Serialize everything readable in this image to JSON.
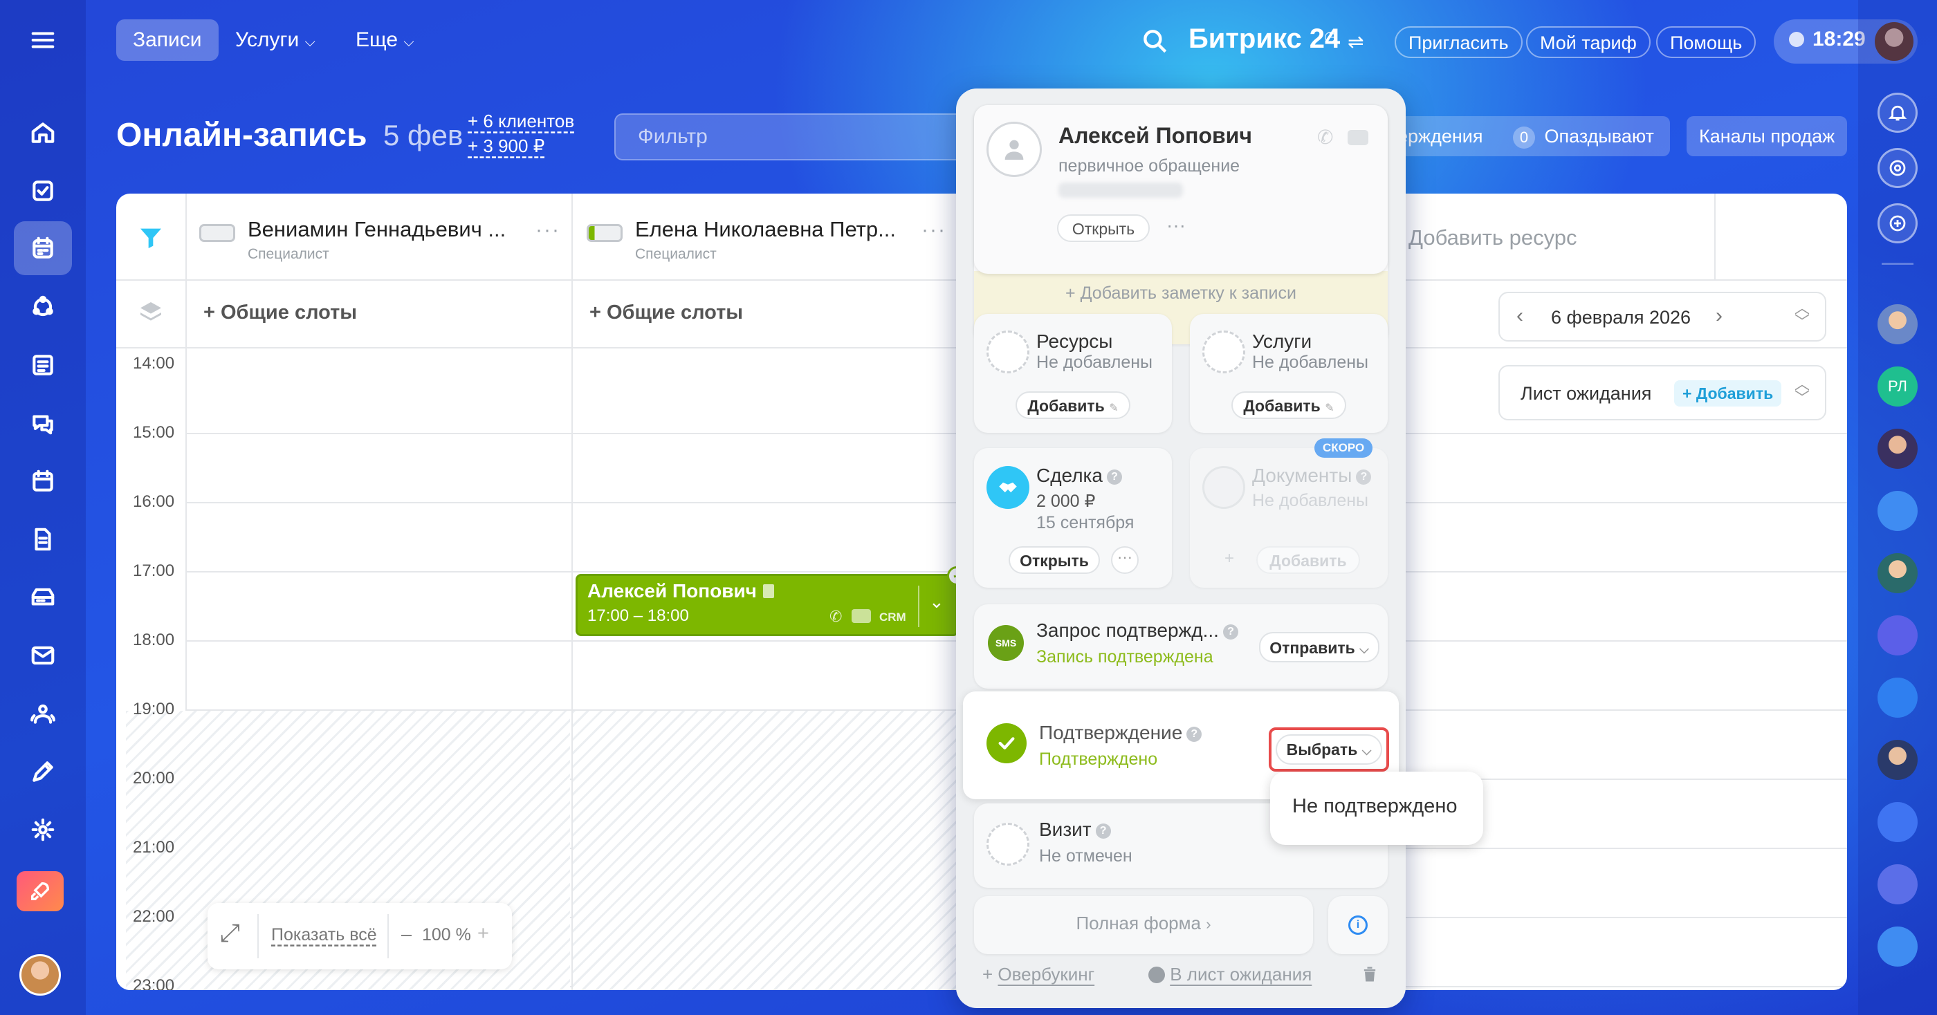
{
  "topbar": {
    "tabs": [
      {
        "label": "Записи"
      },
      {
        "label": "Услуги"
      },
      {
        "label": "Еще"
      }
    ],
    "brand": "Битрикс 24",
    "buttons": {
      "invite": "Пригласить",
      "tariff": "Мой тариф",
      "help": "Помощь"
    },
    "time": "18:29"
  },
  "header": {
    "title": "Онлайн-запись",
    "date": "5 фев",
    "stat_clients": "+ 6 клиентов",
    "stat_sum": "+ 3 900 ₽",
    "filter_placeholder": "Фильтр",
    "confirm_partial": "ерждения",
    "late_count": "0",
    "late_label": "Опаздывают",
    "sales_channels": "Каналы продаж"
  },
  "calendar": {
    "resources": [
      {
        "name": "Вениамин Геннадьевич ...",
        "role": "Специалист"
      },
      {
        "name": "Елена Николаевна Петр...",
        "role": "Специалист"
      }
    ],
    "add_resource": "Добавить ресурс",
    "common_slots": "+ Общие слоты",
    "hours": [
      "14:00",
      "15:00",
      "16:00",
      "17:00",
      "18:00",
      "19:00",
      "20:00",
      "21:00",
      "22:00",
      "23:00"
    ],
    "event": {
      "name": "Алексей Попович",
      "time": "17:00 – 18:00",
      "crm": "CRM"
    },
    "date_nav": "6 февраля 2026",
    "waitlist": {
      "label": "Лист ожидания",
      "add": "+ Добавить"
    },
    "zoom": {
      "show_all": "Показать всё",
      "minus": "–",
      "value": "100 %",
      "plus": "+"
    }
  },
  "popup": {
    "client": {
      "name": "Алексей Попович",
      "type": "первичное обращение",
      "open": "Открыть"
    },
    "add_note": "+ Добавить заметку к записи",
    "resources": {
      "title": "Ресурсы",
      "value": "Не добавлены",
      "button": "Добавить"
    },
    "services": {
      "title": "Услуги",
      "value": "Не добавлены",
      "button": "Добавить"
    },
    "deal": {
      "title": "Сделка",
      "amount": "2 000 ₽",
      "date": "15 сентября",
      "button": "Открыть"
    },
    "documents": {
      "badge": "СКОРО",
      "title": "Документы",
      "value": "Не добавлены",
      "button": "Добавить"
    },
    "request": {
      "title": "Запрос подтвержд...",
      "status": "Запись подтверждена",
      "button": "Отправить",
      "icon_text": "SMS"
    },
    "confirmation": {
      "title": "Подтверждение",
      "status": "Подтверждено",
      "button": "Выбрать"
    },
    "dropdown_option": "Не подтверждено",
    "visit": {
      "title": "Визит",
      "status": "Не отмечен"
    },
    "full_form": "Полная форма",
    "overbooking": "Овербукинг",
    "to_waitlist": "В лист ожидания"
  },
  "colors": {
    "accent": "#2fc6f6",
    "green": "#7db700",
    "status_green": "#8dbb1c",
    "highlight_red": "#e84b4b"
  }
}
